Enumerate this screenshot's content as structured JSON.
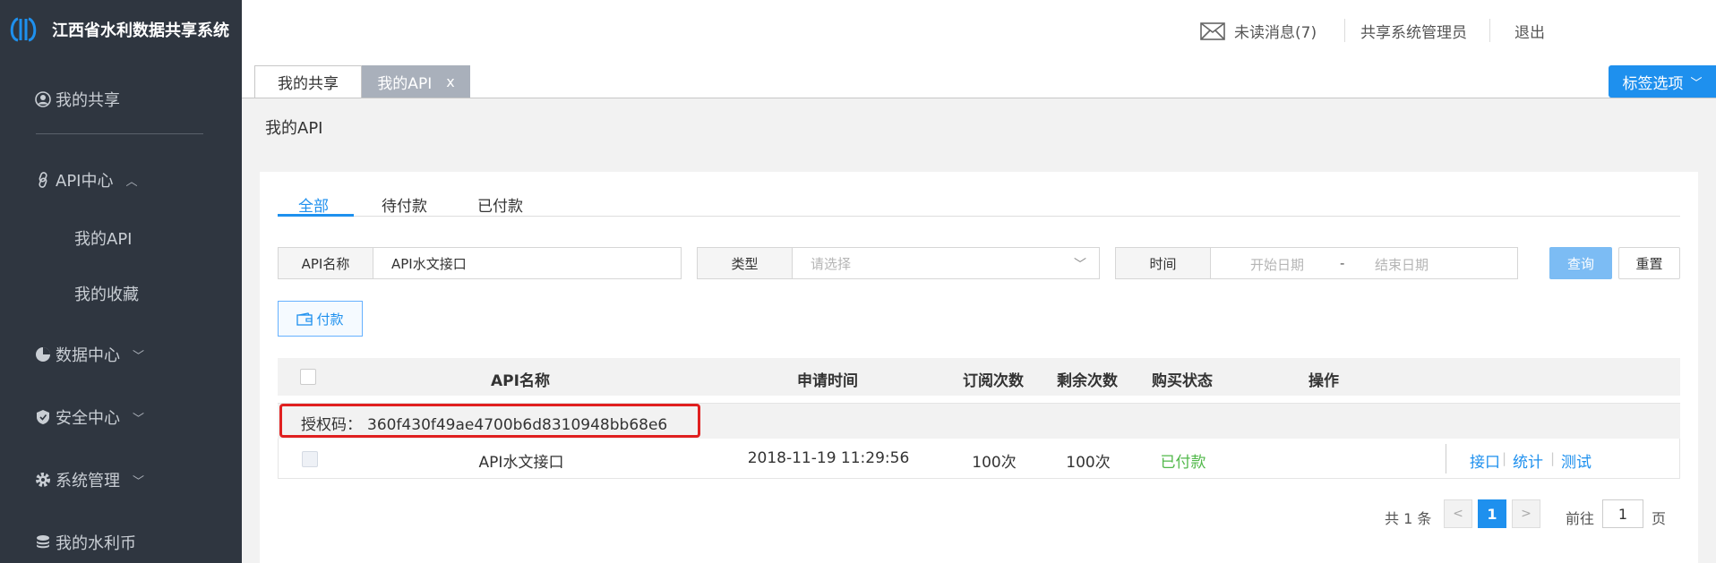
{
  "app": {
    "title": "江西省水利数据共享系统"
  },
  "sidebar": {
    "items": [
      {
        "label": "我的共享",
        "icon": "user-circle-icon"
      },
      {
        "label": "API中心",
        "icon": "link-icon",
        "expanded": true
      },
      {
        "label": "数据中心",
        "icon": "pie-chart-icon"
      },
      {
        "label": "安全中心",
        "icon": "shield-icon"
      },
      {
        "label": "系统管理",
        "icon": "gear-icon"
      },
      {
        "label": "我的水利币",
        "icon": "coin-stack-icon"
      }
    ],
    "api_sub": [
      "我的API",
      "我的收藏"
    ]
  },
  "header": {
    "messages": "未读消息(7)",
    "user": "共享系统管理员",
    "logout": "退出"
  },
  "tabs": {
    "items": [
      "我的共享",
      "我的API"
    ],
    "close_glyph": "x",
    "options_label": "标签选项"
  },
  "page_title": "我的API",
  "sub_tabs": [
    "全部",
    "待付款",
    "已付款"
  ],
  "filters": {
    "api_name_label": "API名称",
    "api_name_value": "API水文接口",
    "type_label": "类型",
    "type_placeholder": "请选择",
    "time_label": "时间",
    "start_placeholder": "开始日期",
    "date_sep": "-",
    "end_placeholder": "结束日期",
    "query": "查询",
    "reset": "重置"
  },
  "pay_button": "付款",
  "table": {
    "columns": [
      "API名称",
      "申请时间",
      "订阅次数",
      "剩余次数",
      "购买状态",
      "操作"
    ],
    "auth_label": "授权码：",
    "auth_code": "360f430f49ae4700b6d8310948bb68e6",
    "rows": [
      {
        "name": "API水文接口",
        "time": "2018-11-19 11:29:56",
        "subscribed": "100次",
        "remaining": "100次",
        "status": "已付款",
        "ops": [
          "接口",
          "统计",
          "测试"
        ]
      }
    ]
  },
  "pagination": {
    "total": "共 1 条",
    "current": "1",
    "goto_label": "前往",
    "goto_value": "1",
    "page_label": "页"
  },
  "colors": {
    "sidebar": "#2f3640",
    "accent": "#1e90ee",
    "paid": "#51b84a",
    "highlight": "#e02020"
  }
}
